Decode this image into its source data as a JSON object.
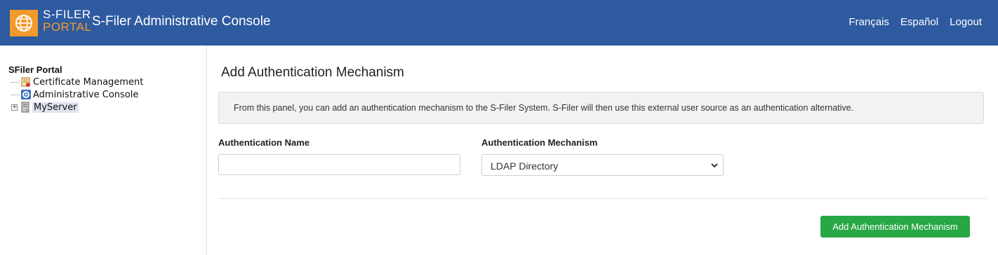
{
  "header": {
    "logo_line1": "S-FILER",
    "logo_line2": "PORTAL",
    "title": "S-Filer Administrative Console",
    "nav": [
      "Français",
      "Español",
      "Logout"
    ],
    "colors": {
      "bar": "#2e5aa0",
      "logo": "#f39a2b"
    }
  },
  "sidebar": {
    "root": "SFiler Portal",
    "items": [
      {
        "label": "Certificate Management",
        "icon": "certificate-icon"
      },
      {
        "label": "Administrative Console",
        "icon": "admin-console-icon"
      },
      {
        "label": "MyServer",
        "icon": "server-icon",
        "expandable": true,
        "selected": true
      }
    ]
  },
  "main": {
    "title": "Add Authentication Mechanism",
    "info": "From this panel, you can add an authentication mechanism to the S-Filer System. S-Filer will then use this external user source as an authentication alternative.",
    "name_label": "Authentication Name",
    "name_value": "",
    "mechanism_label": "Authentication Mechanism",
    "mechanism_value": "LDAP Directory",
    "submit_label": "Add Authentication Mechanism",
    "colors": {
      "submit": "#28a745"
    }
  }
}
